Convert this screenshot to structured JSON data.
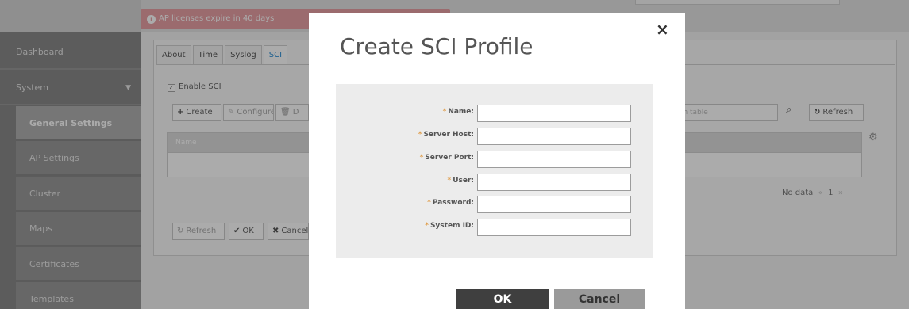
{
  "alert": {
    "text": "AP licenses expire in 40 days",
    "icon": "info-icon"
  },
  "sidebar": {
    "items": [
      {
        "label": "Dashboard"
      },
      {
        "label": "System",
        "caret": "▼"
      },
      {
        "label": "General Settings",
        "active": true
      },
      {
        "label": "AP Settings"
      },
      {
        "label": "Cluster"
      },
      {
        "label": "Maps"
      },
      {
        "label": "Certificates"
      },
      {
        "label": "Templates"
      }
    ]
  },
  "tabs": [
    {
      "label": "About"
    },
    {
      "label": "Time"
    },
    {
      "label": "Syslog"
    },
    {
      "label": "SCI",
      "active": true
    }
  ],
  "enable_sci": {
    "label": "Enable SCI",
    "checked": true
  },
  "toolbar": {
    "create": "Create",
    "configure": "Configure",
    "delete_partial": "D",
    "search_placeholder": "rch table",
    "refresh": "Refresh"
  },
  "table": {
    "columns": [
      "Name"
    ],
    "empty_text": "No data",
    "page": "1"
  },
  "footer_buttons": {
    "refresh": "Refresh",
    "ok": "OK",
    "cancel": "Cancel"
  },
  "modal": {
    "title": "Create SCI Profile",
    "close": "×",
    "fields": [
      {
        "label": "Name:",
        "value": ""
      },
      {
        "label": "Server Host:",
        "value": ""
      },
      {
        "label": "Server Port:",
        "value": ""
      },
      {
        "label": "User:",
        "value": ""
      },
      {
        "label": "Password:",
        "value": ""
      },
      {
        "label": "System ID:",
        "value": ""
      }
    ],
    "ok": "OK",
    "cancel": "Cancel"
  },
  "colors": {
    "accent": "#2d8fd5",
    "alert": "#e8a0a5",
    "required": "#e0a050"
  }
}
